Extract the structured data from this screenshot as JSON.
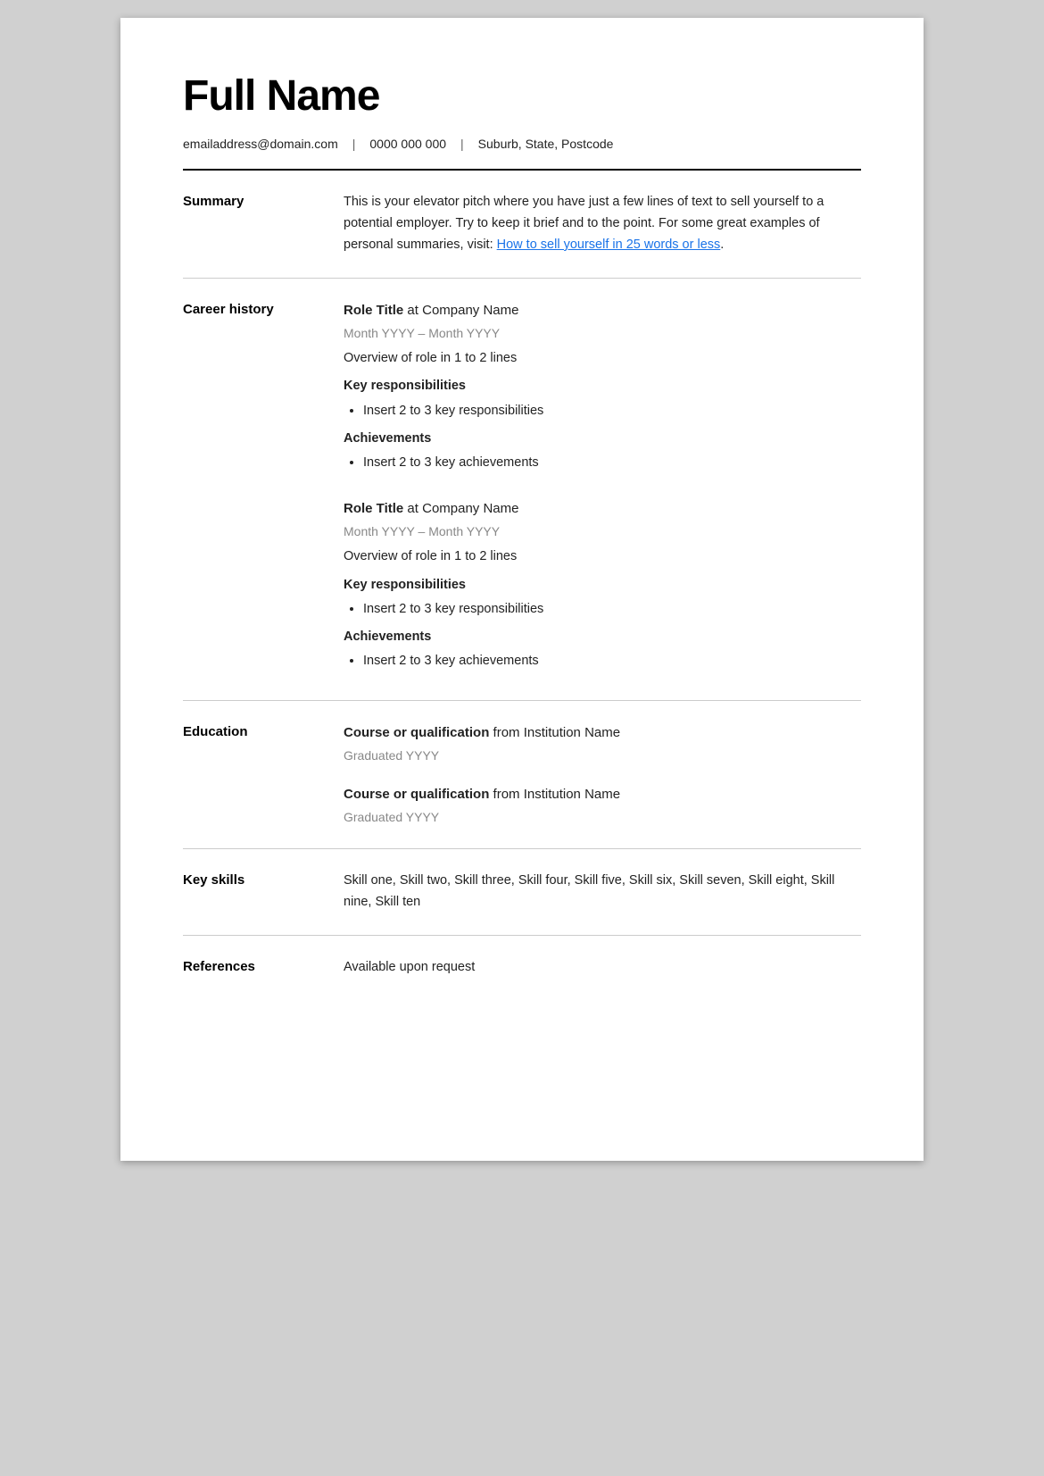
{
  "header": {
    "name": "Full Name",
    "email": "emailaddress@domain.com",
    "phone": "0000 000 000",
    "location": "Suburb, State, Postcode"
  },
  "summary": {
    "label": "Summary",
    "text_before_link": "This is your elevator pitch where you have just a few lines of text to sell yourself to a potential employer. Try to keep it brief and to the point. For some great examples of personal summaries, visit: ",
    "link_text": "How to sell yourself in 25 words or less",
    "text_after_link": "."
  },
  "career_history": {
    "label": "Career history",
    "jobs": [
      {
        "title": "Role Title",
        "company": "Company Name",
        "date": "Month YYYY – Month YYYY",
        "overview": "Overview of role in 1 to 2 lines",
        "responsibilities_label": "Key responsibilities",
        "responsibilities": [
          "Insert 2 to 3 key responsibilities"
        ],
        "achievements_label": "Achievements",
        "achievements": [
          "Insert 2 to 3 key achievements"
        ]
      },
      {
        "title": "Role Title",
        "company": "Company Name",
        "date": "Month YYYY – Month YYYY",
        "overview": "Overview of role in 1 to 2 lines",
        "responsibilities_label": "Key responsibilities",
        "responsibilities": [
          "Insert 2 to 3 key responsibilities"
        ],
        "achievements_label": "Achievements",
        "achievements": [
          "Insert 2 to 3 key achievements"
        ]
      }
    ]
  },
  "education": {
    "label": "Education",
    "entries": [
      {
        "course_bold": "Course or qualification",
        "institution": "from Institution Name",
        "graduated": "Graduated YYYY"
      },
      {
        "course_bold": "Course or qualification",
        "institution": "from Institution Name",
        "graduated": "Graduated YYYY"
      }
    ]
  },
  "key_skills": {
    "label": "Key skills",
    "skills": "Skill one, Skill two, Skill three, Skill four, Skill five, Skill six, Skill seven, Skill eight, Skill nine, Skill ten"
  },
  "references": {
    "label": "References",
    "text": "Available upon request"
  }
}
